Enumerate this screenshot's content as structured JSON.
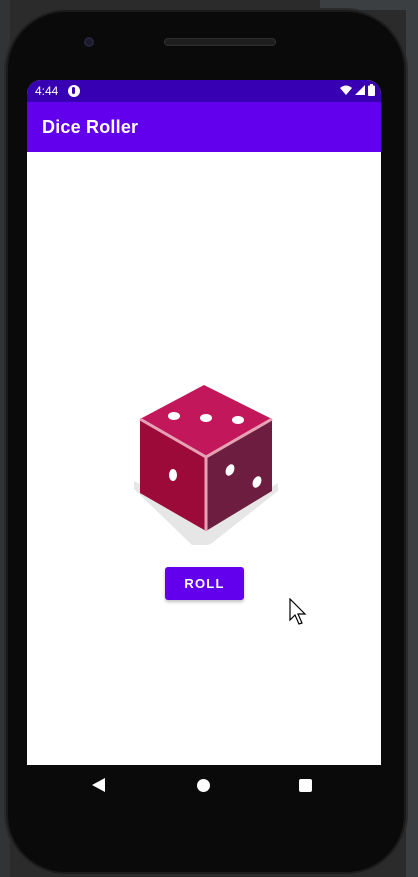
{
  "status_bar": {
    "time": "4:44"
  },
  "app_bar": {
    "title": "Dice Roller"
  },
  "main": {
    "roll_button_label": "ROLL",
    "dice_face_value": 3
  },
  "navigation": {
    "back_icon": "back-triangle",
    "home_icon": "home-circle",
    "recents_icon": "recents-square"
  },
  "colors": {
    "status_bar": "#3700b3",
    "app_bar": "#6200ee",
    "button": "#6200ee",
    "dice_top": "#c2185b",
    "dice_left": "#9c0a3a",
    "dice_right": "#6d1d3f",
    "dice_edge": "#e6a2b4"
  }
}
